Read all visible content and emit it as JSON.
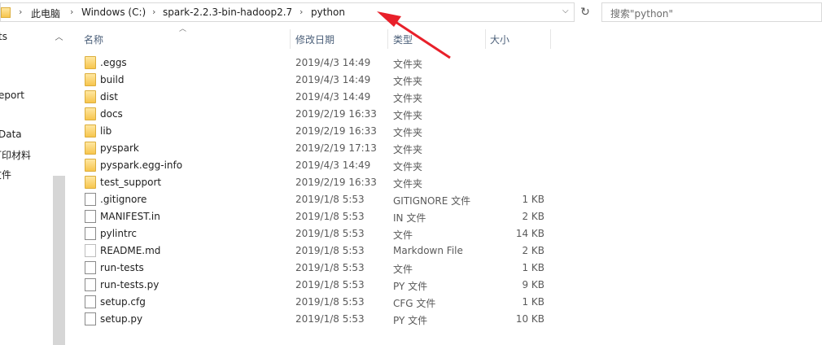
{
  "address": {
    "crumbs": [
      "此电脑",
      "Windows (C:)",
      "spark-2.2.3-bin-hadoop2.7",
      "python"
    ],
    "separator": "›"
  },
  "search": {
    "placeholder": "搜索\"python\""
  },
  "nav": {
    "items": [
      "ts",
      "eport",
      "Data",
      "打印材料",
      "文件"
    ]
  },
  "columns": {
    "name": "名称",
    "date": "修改日期",
    "type": "类型",
    "size": "大小"
  },
  "files": [
    {
      "name": ".eggs",
      "date": "2019/4/3 14:49",
      "type": "文件夹",
      "size": "",
      "icon": "folder-icon"
    },
    {
      "name": "build",
      "date": "2019/4/3 14:49",
      "type": "文件夹",
      "size": "",
      "icon": "folder-icon"
    },
    {
      "name": "dist",
      "date": "2019/4/3 14:49",
      "type": "文件夹",
      "size": "",
      "icon": "folder-icon"
    },
    {
      "name": "docs",
      "date": "2019/2/19 16:33",
      "type": "文件夹",
      "size": "",
      "icon": "folder-icon"
    },
    {
      "name": "lib",
      "date": "2019/2/19 16:33",
      "type": "文件夹",
      "size": "",
      "icon": "folder-icon"
    },
    {
      "name": "pyspark",
      "date": "2019/2/19 17:13",
      "type": "文件夹",
      "size": "",
      "icon": "folder-icon"
    },
    {
      "name": "pyspark.egg-info",
      "date": "2019/4/3 14:49",
      "type": "文件夹",
      "size": "",
      "icon": "folder-icon"
    },
    {
      "name": "test_support",
      "date": "2019/2/19 16:33",
      "type": "文件夹",
      "size": "",
      "icon": "folder-icon"
    },
    {
      "name": ".gitignore",
      "date": "2019/1/8 5:53",
      "type": "GITIGNORE 文件",
      "size": "1 KB",
      "icon": "file-icon"
    },
    {
      "name": "MANIFEST.in",
      "date": "2019/1/8 5:53",
      "type": "IN 文件",
      "size": "2 KB",
      "icon": "file-icon"
    },
    {
      "name": "pylintrc",
      "date": "2019/1/8 5:53",
      "type": "文件",
      "size": "14 KB",
      "icon": "file-icon"
    },
    {
      "name": "README.md",
      "date": "2019/1/8 5:53",
      "type": "Markdown File",
      "size": "2 KB",
      "icon": "markdown-file-icon"
    },
    {
      "name": "run-tests",
      "date": "2019/1/8 5:53",
      "type": "文件",
      "size": "1 KB",
      "icon": "file-icon"
    },
    {
      "name": "run-tests.py",
      "date": "2019/1/8 5:53",
      "type": "PY 文件",
      "size": "9 KB",
      "icon": "file-icon"
    },
    {
      "name": "setup.cfg",
      "date": "2019/1/8 5:53",
      "type": "CFG 文件",
      "size": "1 KB",
      "icon": "file-icon"
    },
    {
      "name": "setup.py",
      "date": "2019/1/8 5:53",
      "type": "PY 文件",
      "size": "10 KB",
      "icon": "file-icon"
    }
  ],
  "annotation": {
    "arrow_color": "#e8202a"
  }
}
